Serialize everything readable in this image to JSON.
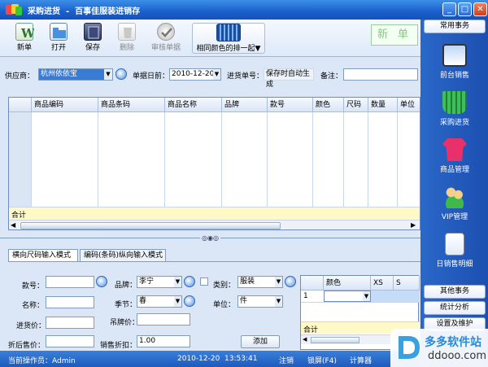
{
  "window": {
    "title": "采购进货  -  百事佳服装进销存",
    "minimize": "_",
    "maximize": "□",
    "close": "✕"
  },
  "toolbar": {
    "buttons": [
      {
        "label": "新单",
        "icon": "new-doc-icon"
      },
      {
        "label": "打开",
        "icon": "open-folder-icon"
      },
      {
        "label": "保存",
        "icon": "save-book-icon"
      },
      {
        "label": "删除",
        "icon": "delete-icon"
      },
      {
        "label": "审核单据",
        "icon": "approve-check-icon"
      },
      {
        "label": "相同颜色的排一起▼",
        "icon": "sort-color-icon"
      }
    ],
    "status_mark": "新 单"
  },
  "form": {
    "supplier_label": "供应商：",
    "supplier_value": "杭州依依宝",
    "date_label": "单据日前：",
    "date_value": "2010-12-20",
    "docno_label": "进货单号：",
    "docno_value": "保存时自动生成",
    "note_label": "备注："
  },
  "grid": {
    "columns": [
      "商品编码",
      "商品条码",
      "商品名称",
      "品牌",
      "款号",
      "颜色",
      "尺码",
      "数量",
      "单位"
    ],
    "total_label": "合计"
  },
  "tabs": [
    "横向尺码输入模式",
    "编码(条码)纵向输入模式"
  ],
  "entry": {
    "style_label": "款号：",
    "brand_label": "品牌：",
    "brand_value": "李宁",
    "category_label": "类别：",
    "category_value": "服装",
    "name_label": "名称：",
    "season_label": "季节：",
    "season_value": "春",
    "unit_label": "单位：",
    "unit_value": "件",
    "tag_price_label": "吊牌价：",
    "purchase_price_label": "进货价：",
    "discount_price_label": "折后售价：",
    "sales_discount_label": "销售折扣：",
    "sales_discount_value": "1.00",
    "add_button": "添加"
  },
  "mini_grid": {
    "columns": [
      "颜色",
      "XS",
      "S"
    ],
    "row_number": "1",
    "total_label": "合计"
  },
  "statusbar": {
    "operator": "当前操作员：Admin",
    "datetime": "2010-12-20  13:53:41",
    "logout": "注销",
    "lock": "锁屏(F4)",
    "calculator": "计算器"
  },
  "sidebar": {
    "header": "常用事务",
    "items": [
      {
        "label": "前台销售",
        "icon": "laptop-icon"
      },
      {
        "label": "采购进货",
        "icon": "shopping-basket-icon"
      },
      {
        "label": "商品管理",
        "icon": "tshirt-icon"
      },
      {
        "label": "VIP管理",
        "icon": "vip-users-icon"
      },
      {
        "label": "日销售明细",
        "icon": "document-search-icon"
      }
    ],
    "other_header": "其他事务",
    "stats": "统计分析",
    "settings": "设置及维护"
  },
  "watermark": {
    "brand": "多多软件站",
    "url": "ddooo.com"
  },
  "colors": {
    "accent": "#1a5fcc",
    "total_row": "#fff9c8",
    "new_mark": "#7bcf7b"
  }
}
